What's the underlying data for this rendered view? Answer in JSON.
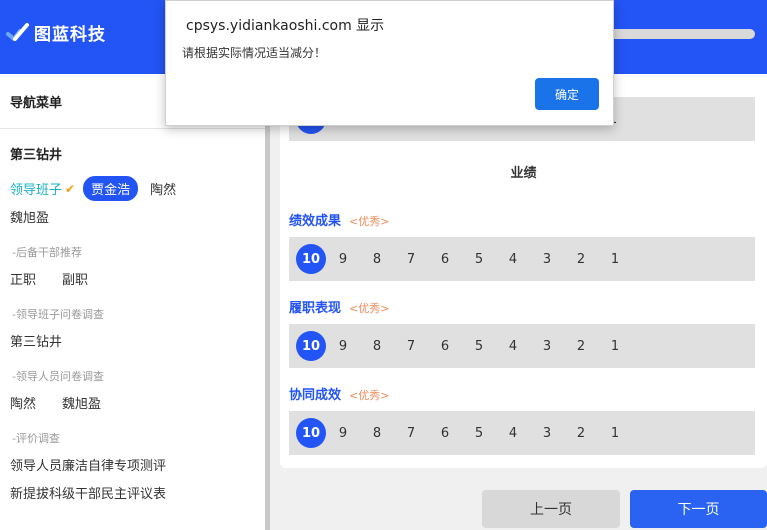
{
  "header": {
    "brand": "图蓝科技",
    "progress_fraction": 1.0
  },
  "sidebar": {
    "nav_title": "导航菜单",
    "unit_name": "第三钻井",
    "leaders": {
      "label": "领导班子",
      "selected": "贾金浩",
      "others": [
        "陶然",
        "魏旭盈"
      ]
    },
    "reserve": {
      "title": "-后备干部推荐",
      "items": [
        "正职",
        "副职"
      ]
    },
    "team_survey": {
      "title": "-领导班子问卷调查",
      "items": [
        "第三钻井"
      ]
    },
    "person_survey": {
      "title": "-领导人员问卷调查",
      "items": [
        "陶然",
        "魏旭盈"
      ]
    },
    "evaluation": {
      "title": "-评价调查",
      "items": [
        "领导人员廉洁自律专项测评",
        "新提拔科级干部民主评议表"
      ]
    }
  },
  "main": {
    "top_partial_score": {
      "visible_last": "1"
    },
    "block_title": "业绩",
    "scores": [
      "10",
      "9",
      "8",
      "7",
      "6",
      "5",
      "4",
      "3",
      "2",
      "1"
    ],
    "metrics": [
      {
        "label": "绩效成果",
        "level": "<优秀>",
        "selected": "10"
      },
      {
        "label": "履职表现",
        "level": "<优秀>",
        "selected": "10"
      },
      {
        "label": "协同成效",
        "level": "<优秀>",
        "selected": "10"
      }
    ]
  },
  "footer": {
    "prev_label": "上一页",
    "next_label": "下一页"
  },
  "dialog": {
    "title": "cpsys.yidiankaoshi.com 显示",
    "message": "请根据实际情况适当减分！",
    "ok_label": "确定"
  },
  "colors": {
    "primary": "#2354f5",
    "teal": "#19b0c4",
    "orange": "#f08c5a",
    "check": "#f39c12"
  }
}
